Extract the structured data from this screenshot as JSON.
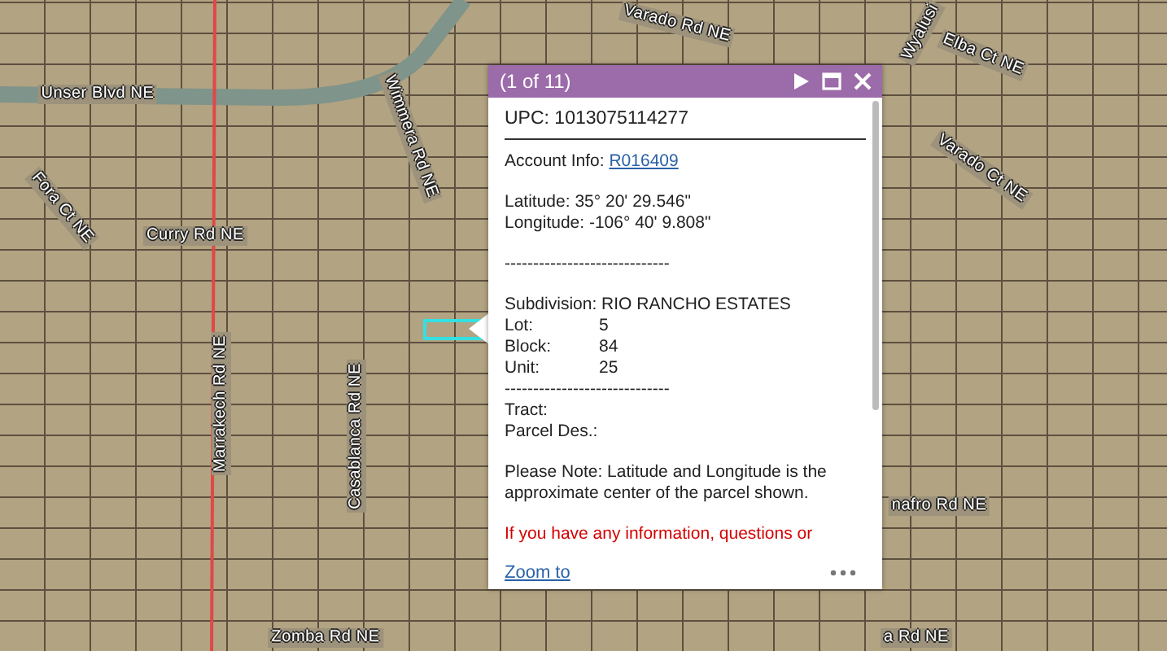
{
  "map": {
    "roads": [
      {
        "label": "Unser Blvd NE"
      },
      {
        "label": "Wimmera Rd NE"
      },
      {
        "label": "Fora Ct NE"
      },
      {
        "label": "Curry Rd NE"
      },
      {
        "label": "Marrakech Rd NE"
      },
      {
        "label": "Casablanca Rd NE"
      },
      {
        "label": "Zomba Rd NE"
      },
      {
        "label": "Varado Rd NE"
      },
      {
        "label": "Wyalusi"
      },
      {
        "label": "Elba Ct NE"
      },
      {
        "label": "Varado Ct NE"
      },
      {
        "label": "nafro Rd NE"
      },
      {
        "label": "a Rd NE"
      }
    ]
  },
  "popup": {
    "title": "(1 of 11)",
    "upc": "UPC: 1013075114277",
    "account_label": "Account Info:",
    "account_link": "R016409",
    "latitude": "Latitude: 35° 20' 29.546\"",
    "longitude": "Longitude: -106° 40' 9.808\"",
    "separator": "-----------------------------",
    "subdivision": "Subdivision: RIO RANCHO ESTATES",
    "fields": [
      {
        "label": "Lot:",
        "value": "5"
      },
      {
        "label": "Block:",
        "value": "84"
      },
      {
        "label": "Unit:",
        "value": "25"
      }
    ],
    "separator2": "-----------------------------",
    "tract": "Tract:",
    "parcel_des": "Parcel Des.:",
    "note": "Please Note: Latitude and Longitude is the approximate center of the parcel shown.",
    "warning": "If you have any information, questions or",
    "zoom_link": "Zoom to"
  }
}
